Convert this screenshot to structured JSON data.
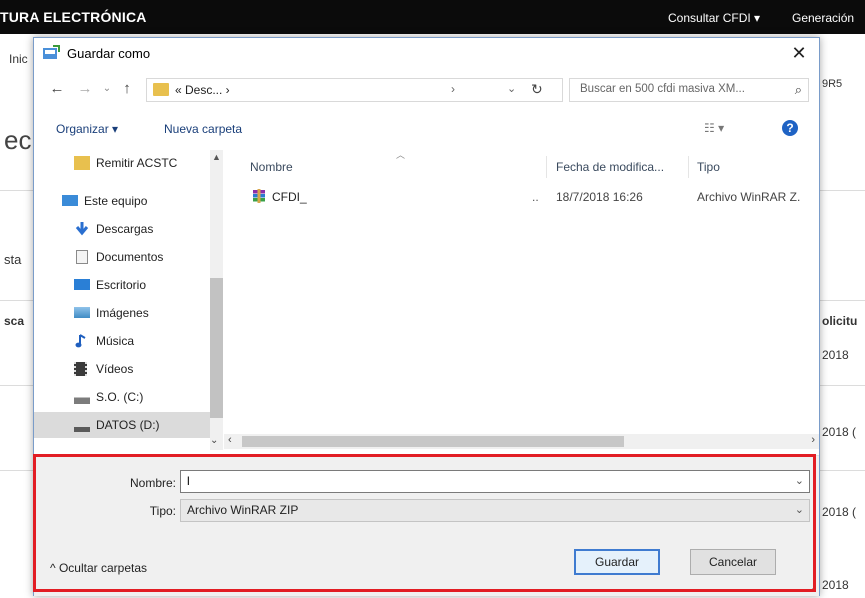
{
  "background": {
    "title": "TURA ELECTRÓNICA",
    "menu_consultar": "Consultar CFDI ▾",
    "menu_generacion": "Generación",
    "left_inic": "Inic",
    "left_ec": "ec",
    "left_sta": "sta",
    "left_sca": "sca",
    "right_9r5": "9R5",
    "right_solicitu": "olicitu",
    "right_dates": [
      "2018",
      "2018 (",
      "2018 (",
      "2018"
    ]
  },
  "dialog": {
    "title": "Guardar como",
    "close_glyph": "✕",
    "nav": {
      "back": "←",
      "forward": "→",
      "dropdown": "⌄",
      "up": "↑",
      "address": "« Desc... ›",
      "address_chevron": "›",
      "address_drop": "⌄",
      "refresh": "↻",
      "search_placeholder": "Buscar en 500 cfdi masiva XM...",
      "search_glyph": "⌕"
    },
    "toolbar": {
      "organize": "Organizar ▾",
      "new_folder": "Nueva carpeta",
      "view": "☷ ▾",
      "help": "?"
    },
    "navpane": {
      "items": [
        {
          "label": "Remitir ACSTC",
          "icon": "folder-icon"
        },
        {
          "label": "Este equipo",
          "icon": "computer-icon"
        },
        {
          "label": "Descargas",
          "icon": "downloads-icon"
        },
        {
          "label": "Documentos",
          "icon": "documents-icon"
        },
        {
          "label": "Escritorio",
          "icon": "desktop-icon"
        },
        {
          "label": "Imágenes",
          "icon": "images-icon"
        },
        {
          "label": "Música",
          "icon": "music-icon"
        },
        {
          "label": "Vídeos",
          "icon": "videos-icon"
        },
        {
          "label": "S.O. (C:)",
          "icon": "drive-c-icon"
        },
        {
          "label": "DATOS (D:)",
          "icon": "drive-d-icon"
        }
      ]
    },
    "filelist": {
      "columns": {
        "name": "Nombre",
        "date": "Fecha de modifica...",
        "type": "Tipo"
      },
      "files": [
        {
          "name": "CFDI_",
          "dots": "..",
          "date": "18/7/2018 16:26",
          "type": "Archivo WinRAR Z."
        }
      ]
    },
    "form": {
      "name_label": "Nombre:",
      "name_value": "l",
      "type_label": "Tipo:",
      "type_value": "Archivo WinRAR ZIP",
      "hide_folders": "^  Ocultar carpetas",
      "save": "Guardar",
      "cancel": "Cancelar"
    }
  },
  "colors": {
    "highlight": "#e21d24",
    "accent": "#1f63c4",
    "topbar": "#0b0b0b"
  }
}
